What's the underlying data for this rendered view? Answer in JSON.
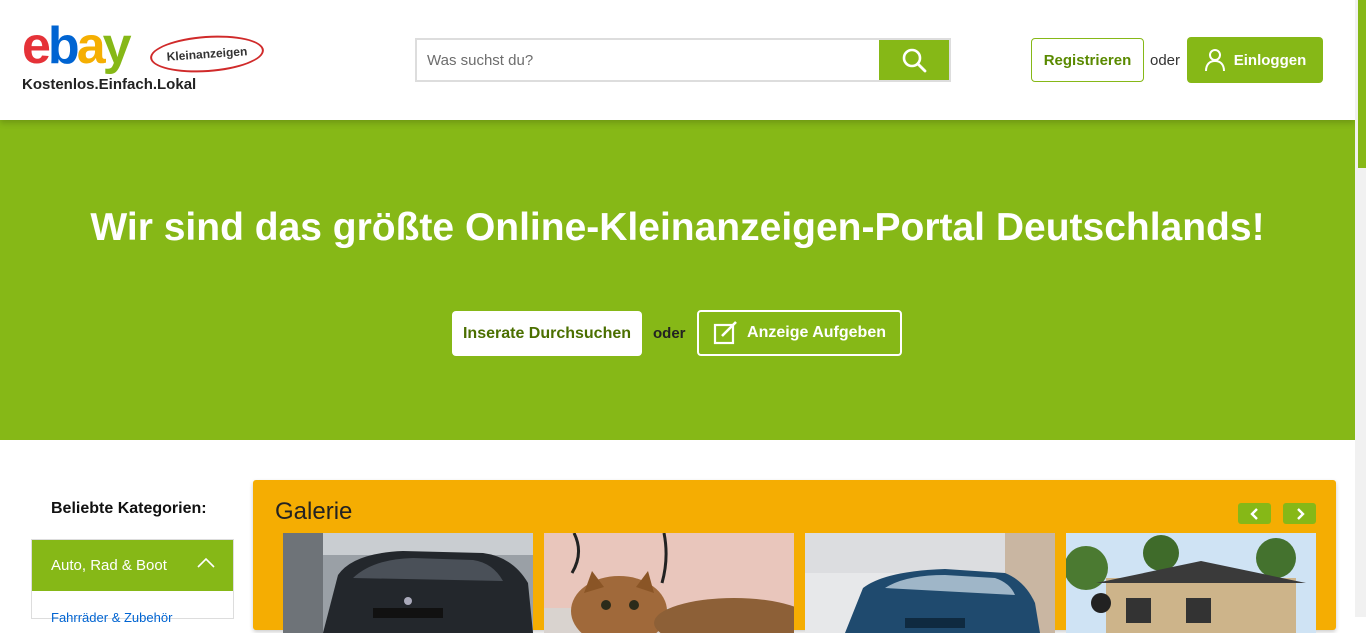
{
  "header": {
    "logo": {
      "brand": "ebay",
      "badge": "Kleinanzeigen",
      "tagline": "Kostenlos.Einfach.Lokal"
    },
    "search": {
      "placeholder": "Was suchst du?",
      "value": "",
      "button_icon": "search-icon"
    },
    "register_label": "Registrieren",
    "oder": "oder",
    "login_label": "Einloggen",
    "login_icon": "user-icon"
  },
  "hero": {
    "title": "Wir sind das größte Online-Kleinanzeigen-Portal Deutschlands!",
    "browse_label": "Inserate Durchsuchen",
    "oder": "oder",
    "post_label": "Anzeige Aufgeben",
    "post_icon": "edit-icon"
  },
  "categories": {
    "title": "Beliebte Kategorien:",
    "active": "Auto, Rad & Boot",
    "sub_first": "Fahrräder & Zubehör"
  },
  "gallery": {
    "title": "Galerie",
    "items": [
      "car-photo",
      "cat-photo",
      "car-photo",
      "house-photo"
    ]
  },
  "colors": {
    "brand_green": "#86b817",
    "gallery_yellow": "#f5ad02",
    "ebay_red": "#e53238",
    "ebay_blue": "#0064d2",
    "ebay_yellow": "#f5af02"
  }
}
